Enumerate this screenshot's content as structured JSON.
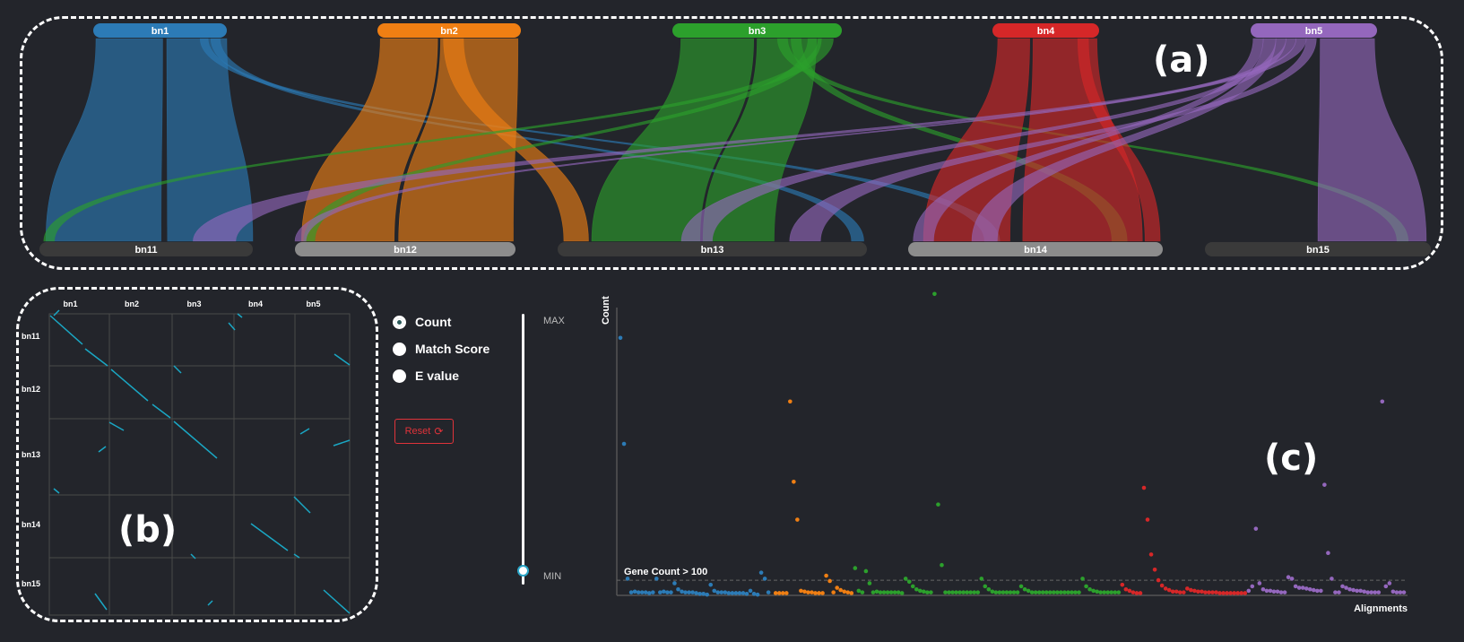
{
  "colors": {
    "bn1": "#2c7bb6",
    "bn2": "#f07f13",
    "bn3": "#2ca02c",
    "bn4": "#d62728",
    "bn5": "#9467bd",
    "bottom_dark": "#3a3a3a",
    "bottom_light": "#8c8c8c",
    "dot_line": "#1aa7c4"
  },
  "panel_labels": {
    "a": "(a)",
    "b": "(b)",
    "c": "(c)"
  },
  "top_chromosomes": [
    "bn1",
    "bn2",
    "bn3",
    "bn4",
    "bn5"
  ],
  "bottom_chromosomes": [
    "bn11",
    "bn12",
    "bn13",
    "bn14",
    "bn15"
  ],
  "dotplot": {
    "col_labels": [
      "bn1",
      "bn2",
      "bn3",
      "bn4",
      "bn5"
    ],
    "row_labels": [
      "bn11",
      "bn12",
      "bn13",
      "bn14",
      "bn15"
    ]
  },
  "controls": {
    "options": [
      {
        "label": "Count",
        "checked": true
      },
      {
        "label": "Match Score",
        "checked": false
      },
      {
        "label": "E value",
        "checked": false
      }
    ],
    "reset_label": "Reset",
    "slider_max_label": "MAX",
    "slider_min_label": "MIN",
    "slider_value": 0.0
  },
  "chart_data": {
    "type": "scatter",
    "xlabel": "Alignments",
    "ylabel": "Count",
    "threshold_label": "Gene Count > 100",
    "threshold": 100,
    "ylim": [
      0,
      1900
    ],
    "xlim": [
      0,
      219
    ],
    "series": [
      {
        "color_key": "bn1",
        "x": [
          1,
          2,
          3,
          4,
          5,
          6,
          7,
          8,
          9,
          10,
          11,
          12,
          13,
          14,
          15,
          16,
          17,
          18,
          19,
          20,
          21,
          22,
          23,
          24,
          25,
          26,
          27,
          28,
          29,
          30,
          31,
          32,
          33,
          34,
          35,
          36,
          37,
          38,
          39,
          40,
          41,
          42
        ],
        "y": [
          1700,
          1000,
          110,
          20,
          25,
          20,
          20,
          20,
          15,
          20,
          110,
          20,
          25,
          20,
          20,
          80,
          40,
          25,
          20,
          20,
          20,
          15,
          10,
          10,
          5,
          70,
          30,
          20,
          20,
          20,
          15,
          15,
          15,
          15,
          15,
          10,
          30,
          10,
          5,
          150,
          110,
          20
        ]
      },
      {
        "color_key": "bn2",
        "x": [
          44,
          45,
          46,
          47,
          48,
          49,
          50,
          51,
          52,
          53,
          54,
          55,
          56,
          57,
          58,
          59,
          60,
          61,
          62,
          63,
          64,
          65
        ],
        "y": [
          15,
          15,
          15,
          15,
          1280,
          750,
          500,
          30,
          25,
          20,
          20,
          15,
          15,
          15,
          130,
          95,
          20,
          50,
          35,
          25,
          20,
          15
        ]
      },
      {
        "color_key": "bn3",
        "x": [
          66,
          67,
          68,
          69,
          70,
          71,
          72,
          73,
          74,
          75,
          76,
          77,
          78,
          79,
          80,
          81,
          82,
          83,
          84,
          85,
          86,
          87,
          88,
          89,
          90,
          91,
          92,
          93,
          94,
          95,
          96,
          97,
          98,
          99,
          100,
          101,
          102,
          103,
          104,
          105,
          106,
          107,
          108,
          109,
          110,
          111,
          112,
          113,
          114,
          115,
          116,
          117,
          118,
          119,
          120,
          121,
          122,
          123,
          124,
          125,
          126,
          127,
          128,
          129,
          130,
          131,
          132,
          133,
          134,
          135,
          136,
          137,
          138,
          139
        ],
        "y": [
          180,
          30,
          20,
          160,
          80,
          20,
          25,
          20,
          20,
          20,
          20,
          20,
          20,
          15,
          110,
          90,
          60,
          40,
          30,
          25,
          20,
          20,
          1990,
          600,
          200,
          20,
          20,
          20,
          20,
          20,
          20,
          20,
          20,
          20,
          20,
          110,
          60,
          40,
          25,
          20,
          20,
          20,
          20,
          20,
          20,
          20,
          60,
          40,
          30,
          20,
          20,
          20,
          20,
          20,
          20,
          20,
          20,
          20,
          20,
          20,
          20,
          20,
          20,
          110,
          60,
          40,
          30,
          25,
          20,
          20,
          20,
          20,
          20,
          20
        ]
      },
      {
        "color_key": "bn4",
        "x": [
          140,
          141,
          142,
          143,
          144,
          145,
          146,
          147,
          148,
          149,
          150,
          151,
          152,
          153,
          154,
          155,
          156,
          157,
          158,
          159,
          160,
          161,
          162,
          163,
          164,
          165,
          166,
          167,
          168,
          169,
          170,
          171,
          172,
          173,
          174
        ],
        "y": [
          70,
          40,
          30,
          20,
          15,
          15,
          710,
          500,
          270,
          170,
          100,
          65,
          45,
          35,
          25,
          25,
          20,
          20,
          45,
          35,
          30,
          25,
          25,
          20,
          20,
          20,
          20,
          15,
          15,
          15,
          15,
          15,
          15,
          15,
          15
        ]
      },
      {
        "color_key": "bn5",
        "x": [
          175,
          176,
          177,
          178,
          179,
          180,
          181,
          182,
          183,
          184,
          185,
          186,
          187,
          188,
          189,
          190,
          191,
          192,
          193,
          194,
          195,
          196,
          197,
          198,
          199,
          200,
          201,
          202,
          203,
          204,
          205,
          206,
          207,
          208,
          209,
          210,
          211,
          212,
          213,
          214,
          215,
          216,
          217,
          218
        ],
        "y": [
          30,
          60,
          440,
          80,
          40,
          30,
          30,
          25,
          25,
          20,
          20,
          120,
          110,
          60,
          50,
          50,
          45,
          40,
          35,
          30,
          30,
          730,
          280,
          110,
          20,
          20,
          60,
          50,
          40,
          35,
          30,
          30,
          25,
          20,
          20,
          20,
          20,
          1280,
          60,
          80,
          25,
          20,
          20,
          20
        ]
      }
    ]
  }
}
